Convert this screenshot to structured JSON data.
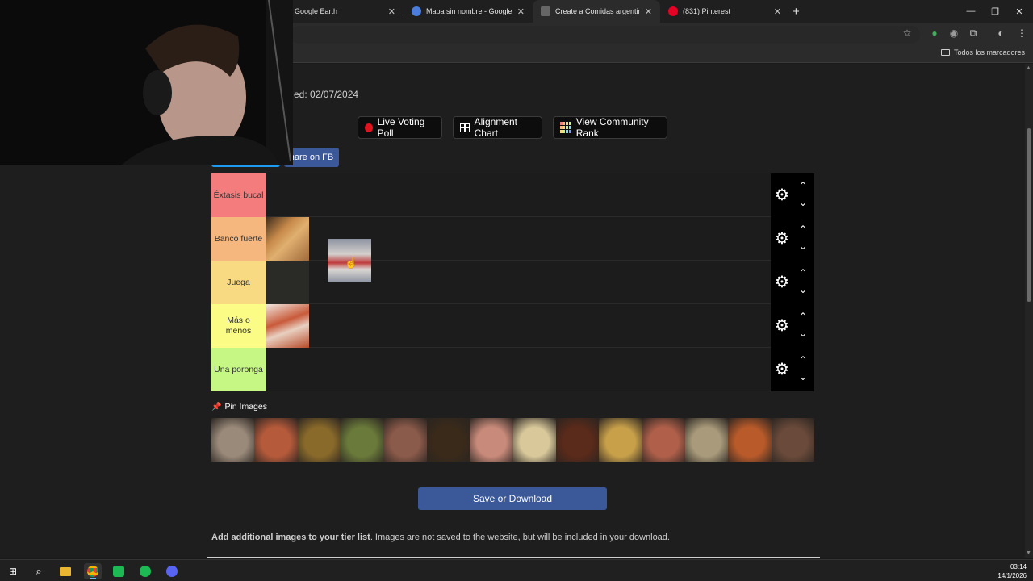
{
  "browser": {
    "tabs": [
      {
        "title": "Google Earth",
        "favicon_color": "#1f1f1f"
      },
      {
        "title": "Mapa sin nombre - Google Earth",
        "favicon_color": "#4a7ddc"
      },
      {
        "title": "Create a Comidas argentinas Tier List",
        "favicon_color": "#555555"
      },
      {
        "title": "(831) Pinterest",
        "favicon_color": "#e60023"
      }
    ],
    "bookmarks_label": "Todos los marcadores"
  },
  "header": {
    "updated_text": "ed: 02/07/2024",
    "buttons": {
      "live_poll": "Live Voting Poll",
      "alignment": "Alignment Chart",
      "community_rank": "View Community Rank"
    },
    "share_fb": "hare on FB"
  },
  "tiers": [
    {
      "label": "Éxtasis bucal",
      "color": "#f47c7c"
    },
    {
      "label": "Banco fuerte",
      "color": "#f6b77f"
    },
    {
      "label": "Juega",
      "color": "#f8da82"
    },
    {
      "label": "Más o menos",
      "color": "#fbfc86"
    },
    {
      "label": "Una poronga",
      "color": "#c6f785"
    }
  ],
  "pool": {
    "label": "Pin Images",
    "tiles": [
      "#9a8a7a",
      "#b55a3a",
      "#8a6a2a",
      "#6a7a3a",
      "#8a5a4a",
      "#3a2a1a",
      "#c88a7a",
      "#d8c89a",
      "#5a2a1a",
      "#c8a04a",
      "#b0604a",
      "#a89a7a",
      "#b85a2a",
      "#6a4a3a"
    ]
  },
  "actions": {
    "save": "Save or Download",
    "addl_bold": "Add additional images to your tier list",
    "addl_rest": ". Images are not saved to the website, but will be included in your download."
  },
  "taskbar": {
    "time": "03:14",
    "date": "14/1/2026"
  }
}
